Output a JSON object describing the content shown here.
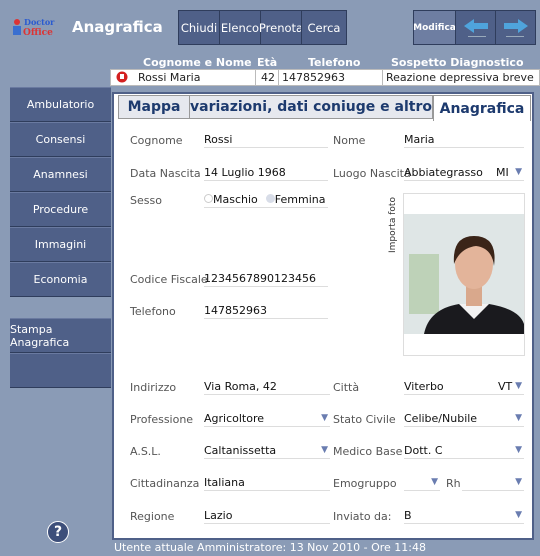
{
  "app": {
    "logo_text": "Doctor Office",
    "title": "Anagrafica"
  },
  "toolbar": {
    "buttons": [
      "Chiudi",
      "Elenco",
      "Prenota",
      "Cerca"
    ],
    "modifica": "Modifica",
    "prev_icon": "arrow-left-icon",
    "next_icon": "arrow-right-icon"
  },
  "patient": {
    "headers": [
      "Cognome e Nome",
      "Età",
      "Telefono",
      "Sospetto Diagnostico"
    ],
    "name": "Rossi Maria",
    "eta": "42",
    "telefono": "147852963",
    "sospetto": "Reazione depressiva breve",
    "status_color": "#d42020"
  },
  "sidebar": {
    "items": [
      "Ambulatorio",
      "Consensi",
      "Anamnesi",
      "Procedure",
      "Immagini",
      "Economia"
    ],
    "stampa": "Stampa Anagrafica",
    "help_icon": "question-icon"
  },
  "tabs": [
    "Mappa",
    "variazioni, dati coniuge e altro",
    "Anagrafica"
  ],
  "form": {
    "cognome": {
      "label": "Cognome",
      "value": "Rossi"
    },
    "nome": {
      "label": "Nome",
      "value": "Maria"
    },
    "data_nascita": {
      "label": "Data Nascita",
      "value": "14 Luglio 1968"
    },
    "luogo_nascita": {
      "label": "Luogo Nascita",
      "value": "Abbiategrasso",
      "prov": "MI"
    },
    "sesso": {
      "label": "Sesso",
      "options": [
        "Maschio",
        "Femmina"
      ],
      "selected": "Femmina"
    },
    "importa_foto": "Importa foto",
    "codice_fiscale": {
      "label": "Codice Fiscale",
      "value": "1234567890123456"
    },
    "telefono": {
      "label": "Telefono",
      "value": "147852963"
    },
    "indirizzo": {
      "label": "Indirizzo",
      "value": "Via Roma, 42"
    },
    "citta": {
      "label": "Città",
      "value": "Viterbo",
      "prov": "VT"
    },
    "professione": {
      "label": "Professione",
      "value": "Agricoltore"
    },
    "stato_civile": {
      "label": "Stato Civile",
      "value": "Celibe/Nubile"
    },
    "asl": {
      "label": "A.S.L.",
      "value": "Caltanissetta"
    },
    "medico_base": {
      "label": "Medico Base",
      "value": "Dott. C"
    },
    "cittadinanza": {
      "label": "Cittadinanza",
      "value": "Italiana"
    },
    "emogruppo": {
      "label": "Emogruppo",
      "value": "",
      "rh_label": "Rh",
      "rh_value": ""
    },
    "regione": {
      "label": "Regione",
      "value": "Lazio"
    },
    "inviato_da": {
      "label": "Inviato da:",
      "value": "B"
    }
  },
  "footer": {
    "text": "Utente attuale Amministratore:   13 Nov 2010  - Ore 11:48"
  }
}
